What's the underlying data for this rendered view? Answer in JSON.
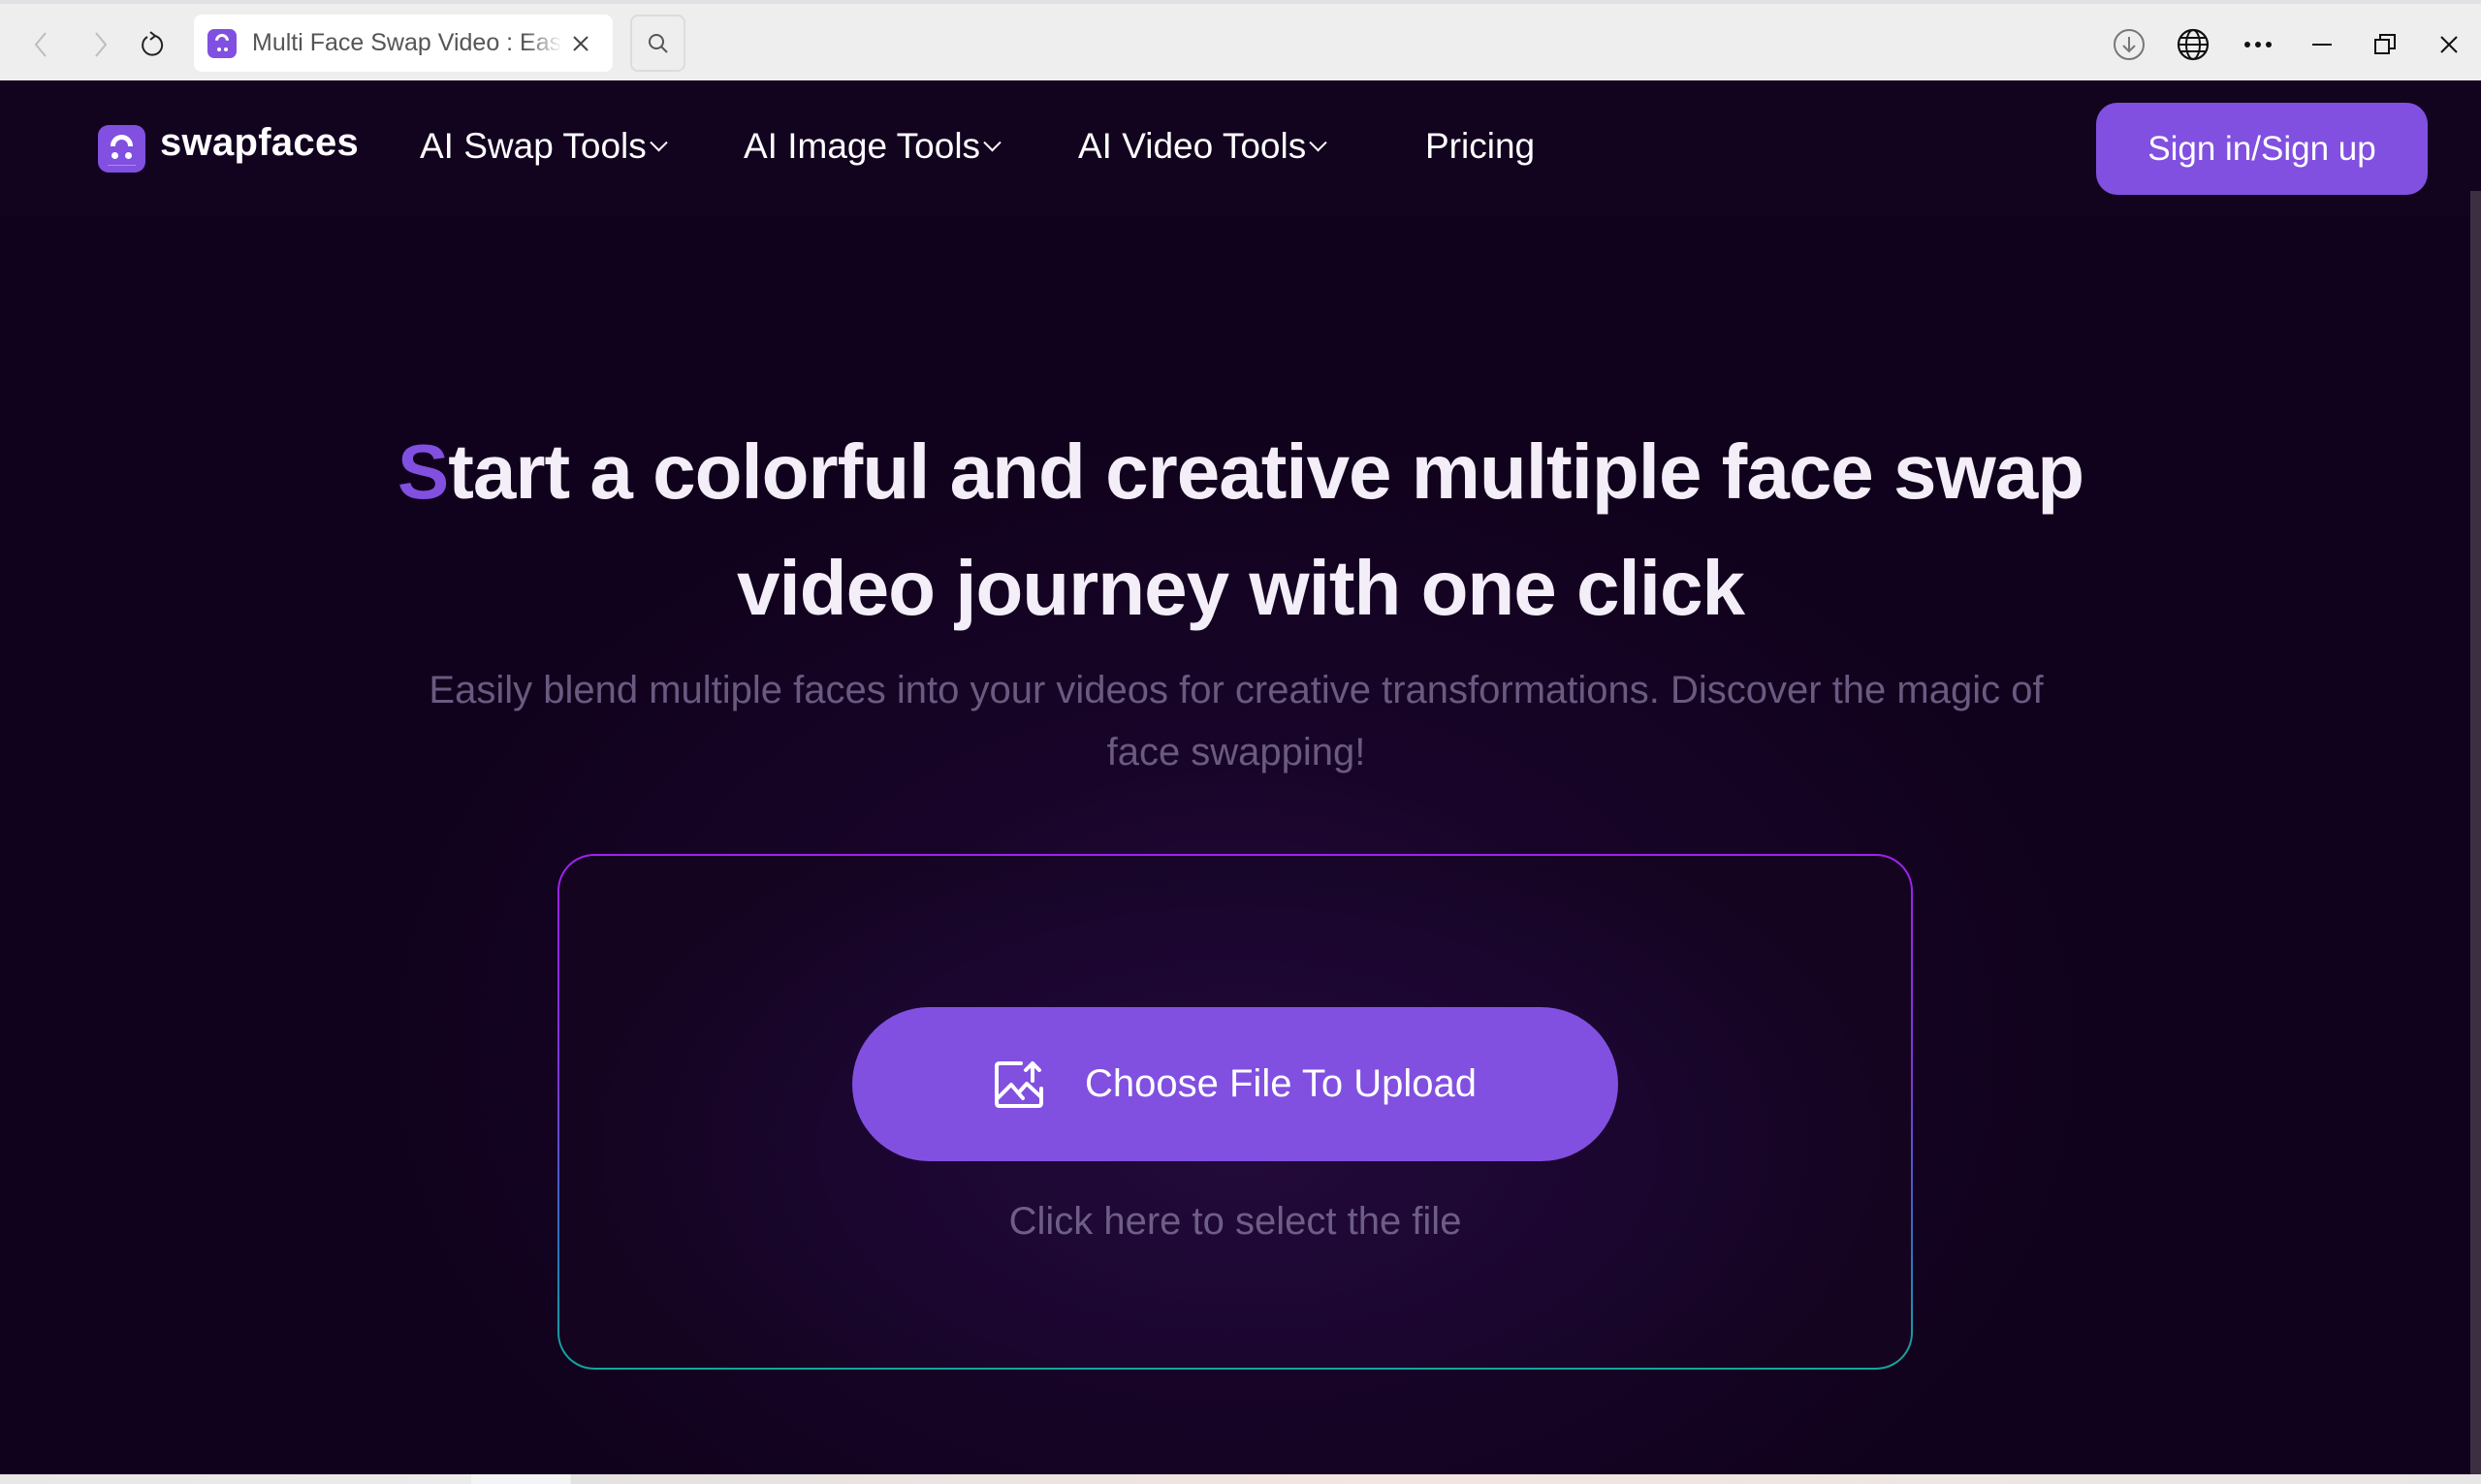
{
  "browser": {
    "tab_title": "Multi Face Swap Video : Easily Swap Multiple Faces",
    "back_icon": "chevron-left-icon",
    "forward_icon": "chevron-right-icon",
    "reload_icon": "reload-icon",
    "search_icon": "search-icon",
    "right_icons": [
      "download-icon",
      "globe-icon",
      "more-icon",
      "minimize-icon",
      "restore-icon",
      "close-icon"
    ]
  },
  "nav": {
    "brand": "swapfaces",
    "items": [
      {
        "label": "AI Swap Tools",
        "has_dropdown": true
      },
      {
        "label": "AI Image Tools",
        "has_dropdown": true
      },
      {
        "label": "AI Video Tools",
        "has_dropdown": true
      },
      {
        "label": "Pricing",
        "has_dropdown": false
      }
    ],
    "signin_label": "Sign in/Sign up"
  },
  "hero": {
    "headline_accent": "S",
    "headline_line1_rest": "tart a colorful and creative multiple face swap",
    "headline_line2": "video journey with one click",
    "subtitle_line1": "Easily blend multiple faces into your videos for creative transformations. Discover the magic of",
    "subtitle_line2": "face swapping!"
  },
  "upload": {
    "button_label": "Choose File To Upload",
    "button_icon": "image-upload-icon",
    "helper_text": "Click here to select the file"
  },
  "colors": {
    "accent": "#8150e0",
    "background": "#10021c",
    "nav_bg": "#12031f",
    "subtitle_text": "#6a5a80",
    "border_top": "#a020f0",
    "border_bottom": "#12a89a"
  }
}
